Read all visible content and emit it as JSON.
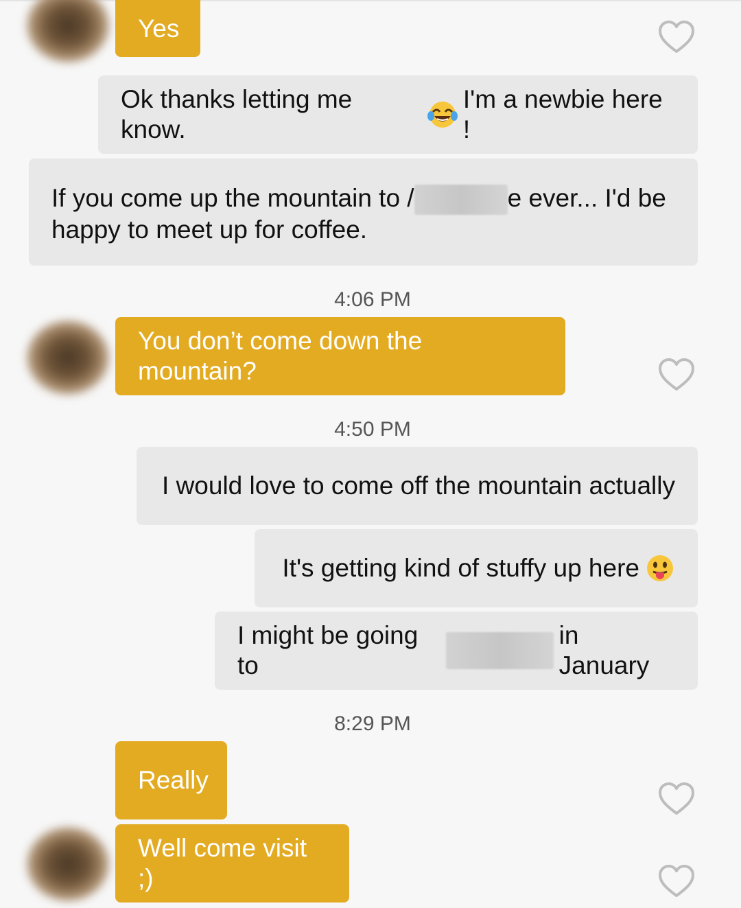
{
  "messages": {
    "m1": {
      "text": "Yes"
    },
    "m2": {
      "before": "Ok thanks letting me know.",
      "emoji": "laughing-tears-emoji",
      "after": "I'm a newbie here !"
    },
    "m3": {
      "before": "If you come up the mountain to /",
      "after": "e ever... I'd be",
      "line2": "happy to meet up for coffee."
    },
    "t1": "4:06 PM",
    "m4": {
      "text": "You don’t come down the mountain?"
    },
    "t2": "4:50 PM",
    "m5": {
      "text": "I would love to come off the mountain actually"
    },
    "m6": {
      "text": "It's getting kind of stuffy up here",
      "emoji": "tongue-out-emoji"
    },
    "m7": {
      "before": "I might be going to",
      "after": "in January"
    },
    "t3": "8:29 PM",
    "m8": {
      "text": "Really"
    },
    "m9": {
      "text": "Well come visit ;)"
    }
  },
  "colors": {
    "incoming_bubble": "#e3ab22",
    "outgoing_bubble": "#e8e8e8",
    "background": "#f7f7f7",
    "heart_outline": "#bdbdbd"
  },
  "icons": {
    "like": "heart-outline-icon",
    "avatar": "blurred-contact-avatar"
  }
}
